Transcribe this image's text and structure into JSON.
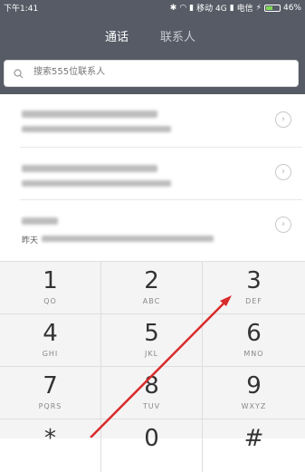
{
  "status": {
    "time": "下午1:41",
    "carrier1": "移动 4G",
    "carrier2": "电信",
    "battery": "46%"
  },
  "tabs": [
    {
      "label": "通话"
    },
    {
      "label": "联系人"
    }
  ],
  "search": {
    "placeholder": "搜索555位联系人"
  },
  "recent_calls": [
    {
      "line1": "",
      "line2": ""
    },
    {
      "line1": "",
      "line2": ""
    },
    {
      "line1": "",
      "line2": "昨天"
    }
  ],
  "keypad": [
    {
      "digit": "1",
      "letters": "QO"
    },
    {
      "digit": "2",
      "letters": "ABC"
    },
    {
      "digit": "3",
      "letters": "DEF"
    },
    {
      "digit": "4",
      "letters": "GHI"
    },
    {
      "digit": "5",
      "letters": "JKL"
    },
    {
      "digit": "6",
      "letters": "MNO"
    },
    {
      "digit": "7",
      "letters": "PQRS"
    },
    {
      "digit": "8",
      "letters": "TUV"
    },
    {
      "digit": "9",
      "letters": "WXYZ"
    },
    {
      "digit": "*",
      "letters": ""
    },
    {
      "digit": "0",
      "letters": ""
    },
    {
      "digit": "#",
      "letters": ""
    }
  ],
  "colors": {
    "header_bg": "#565b66",
    "annotation_red": "#d92b2b"
  }
}
